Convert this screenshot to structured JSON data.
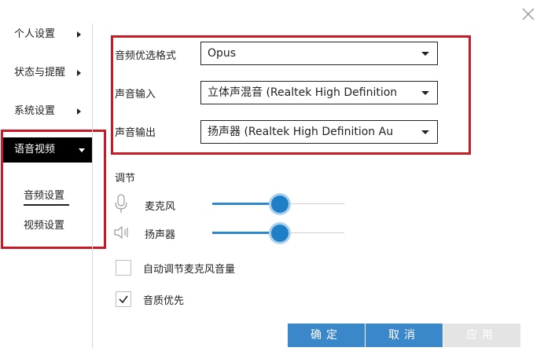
{
  "window": {
    "close_icon": "close-icon"
  },
  "sidebar": {
    "items": [
      {
        "label": "个人设置",
        "icon": "chevron-right-icon"
      },
      {
        "label": "状态与提醒",
        "icon": "chevron-right-icon"
      },
      {
        "label": "系统设置",
        "icon": "chevron-right-icon"
      }
    ],
    "active": {
      "label": "语音视频",
      "icon": "caret-down-icon"
    },
    "sub_items": [
      {
        "label": "音频设置",
        "selected": true
      },
      {
        "label": "视频设置",
        "selected": false
      }
    ]
  },
  "audio": {
    "format_label": "音频优选格式",
    "format_value": "Opus",
    "input_label": "声音输入",
    "input_value": "立体声混音 (Realtek High Definition",
    "output_label": "声音输出",
    "output_value": "扬声器 (Realtek High Definition Au"
  },
  "adjust": {
    "title": "调节",
    "mic": {
      "label": "麦克风",
      "icon": "microphone-icon",
      "level": 0.51
    },
    "speaker": {
      "label": "扬声器",
      "icon": "speaker-icon",
      "level": 0.51
    }
  },
  "options": {
    "auto_mic": {
      "label": "自动调节麦克风音量",
      "checked": false
    },
    "quality_first": {
      "label": "音质优先",
      "checked": true
    }
  },
  "buttons": {
    "ok": "确定",
    "cancel": "取消",
    "apply": "应用"
  },
  "colors": {
    "accent": "#3a87c9",
    "highlight_border": "#c61a26",
    "active_nav_bg": "#000000",
    "disabled_button": "#e4e4e4"
  }
}
